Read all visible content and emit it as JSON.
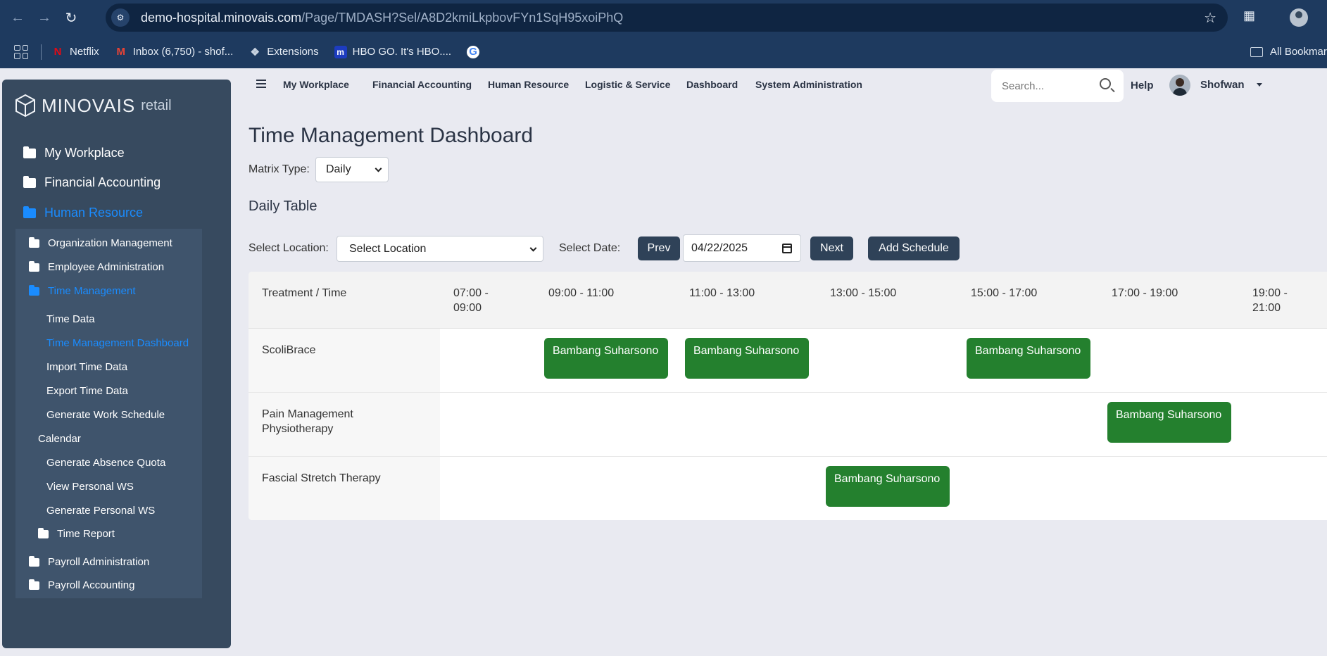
{
  "browser": {
    "url_host": "demo-hospital.minovais.com",
    "url_path": "/Page/TMDASH?Sel/A8D2kmiLkpbovFYn1SqH95xoiPhQ",
    "bookmarks": [
      "Netflix",
      "Inbox (6,750) - shof...",
      "Extensions",
      "HBO GO. It's HBO...."
    ],
    "all_bookmarks": "All Bookmar"
  },
  "logo": {
    "brand": "MINOVAIS",
    "suffix": "retail"
  },
  "sidebar": {
    "top_items": [
      "My Workplace",
      "Financial Accounting",
      "Human Resource"
    ],
    "hr_items": [
      "Organization Management",
      "Employee Administration",
      "Time Management"
    ],
    "tm_items": [
      "Time Data",
      "Time Management Dashboard",
      "Import Time Data",
      "Export Time Data",
      "Generate Work Schedule",
      "Calendar",
      "Generate Absence Quota",
      "View Personal WS",
      "Generate Personal WS",
      "Time Report"
    ],
    "bottom_items": [
      "Payroll Administration",
      "Payroll Accounting"
    ],
    "active_color": "#1a8cff"
  },
  "topnav": {
    "items": [
      "My Workplace",
      "Financial Accounting",
      "Human Resource",
      "Logistic & Service",
      "Dashboard",
      "System Administration"
    ],
    "search_placeholder": "Search...",
    "help": "Help",
    "user": "Shofwan"
  },
  "main": {
    "title": "Time Management Dashboard",
    "matrix_label": "Matrix Type:",
    "matrix_value": "Daily",
    "section_title": "Daily Table",
    "location_label": "Select Location:",
    "location_value": "Select Location",
    "date_label": "Select Date:",
    "prev": "Prev",
    "date_value": "04/22/2025",
    "next": "Next",
    "add_schedule": "Add Schedule"
  },
  "table": {
    "header_first": "Treatment / Time",
    "time_slots": [
      "07:00 - 09:00",
      "09:00 - 11:00",
      "11:00 - 13:00",
      "13:00 - 15:00",
      "15:00 - 17:00",
      "17:00 - 19:00",
      "19:00 - 21:00"
    ],
    "rows": [
      {
        "treatment": "ScoliBrace",
        "bookings": [
          {
            "slot": "09:00 - 11:00",
            "name": "Bambang Suharsono"
          },
          {
            "slot": "11:00 - 13:00",
            "name": "Bambang Suharsono"
          },
          {
            "slot": "15:00 - 17:00",
            "name": "Bambang Suharsono"
          }
        ]
      },
      {
        "treatment": "Pain Management Physiotherapy",
        "bookings": [
          {
            "slot": "17:00 - 19:00",
            "name": "Bambang Suharsono"
          }
        ]
      },
      {
        "treatment": "Fascial Stretch Therapy",
        "bookings": [
          {
            "slot": "13:00 - 15:00",
            "name": "Bambang Suharsono"
          }
        ]
      }
    ],
    "booking_color": "#24802e"
  }
}
